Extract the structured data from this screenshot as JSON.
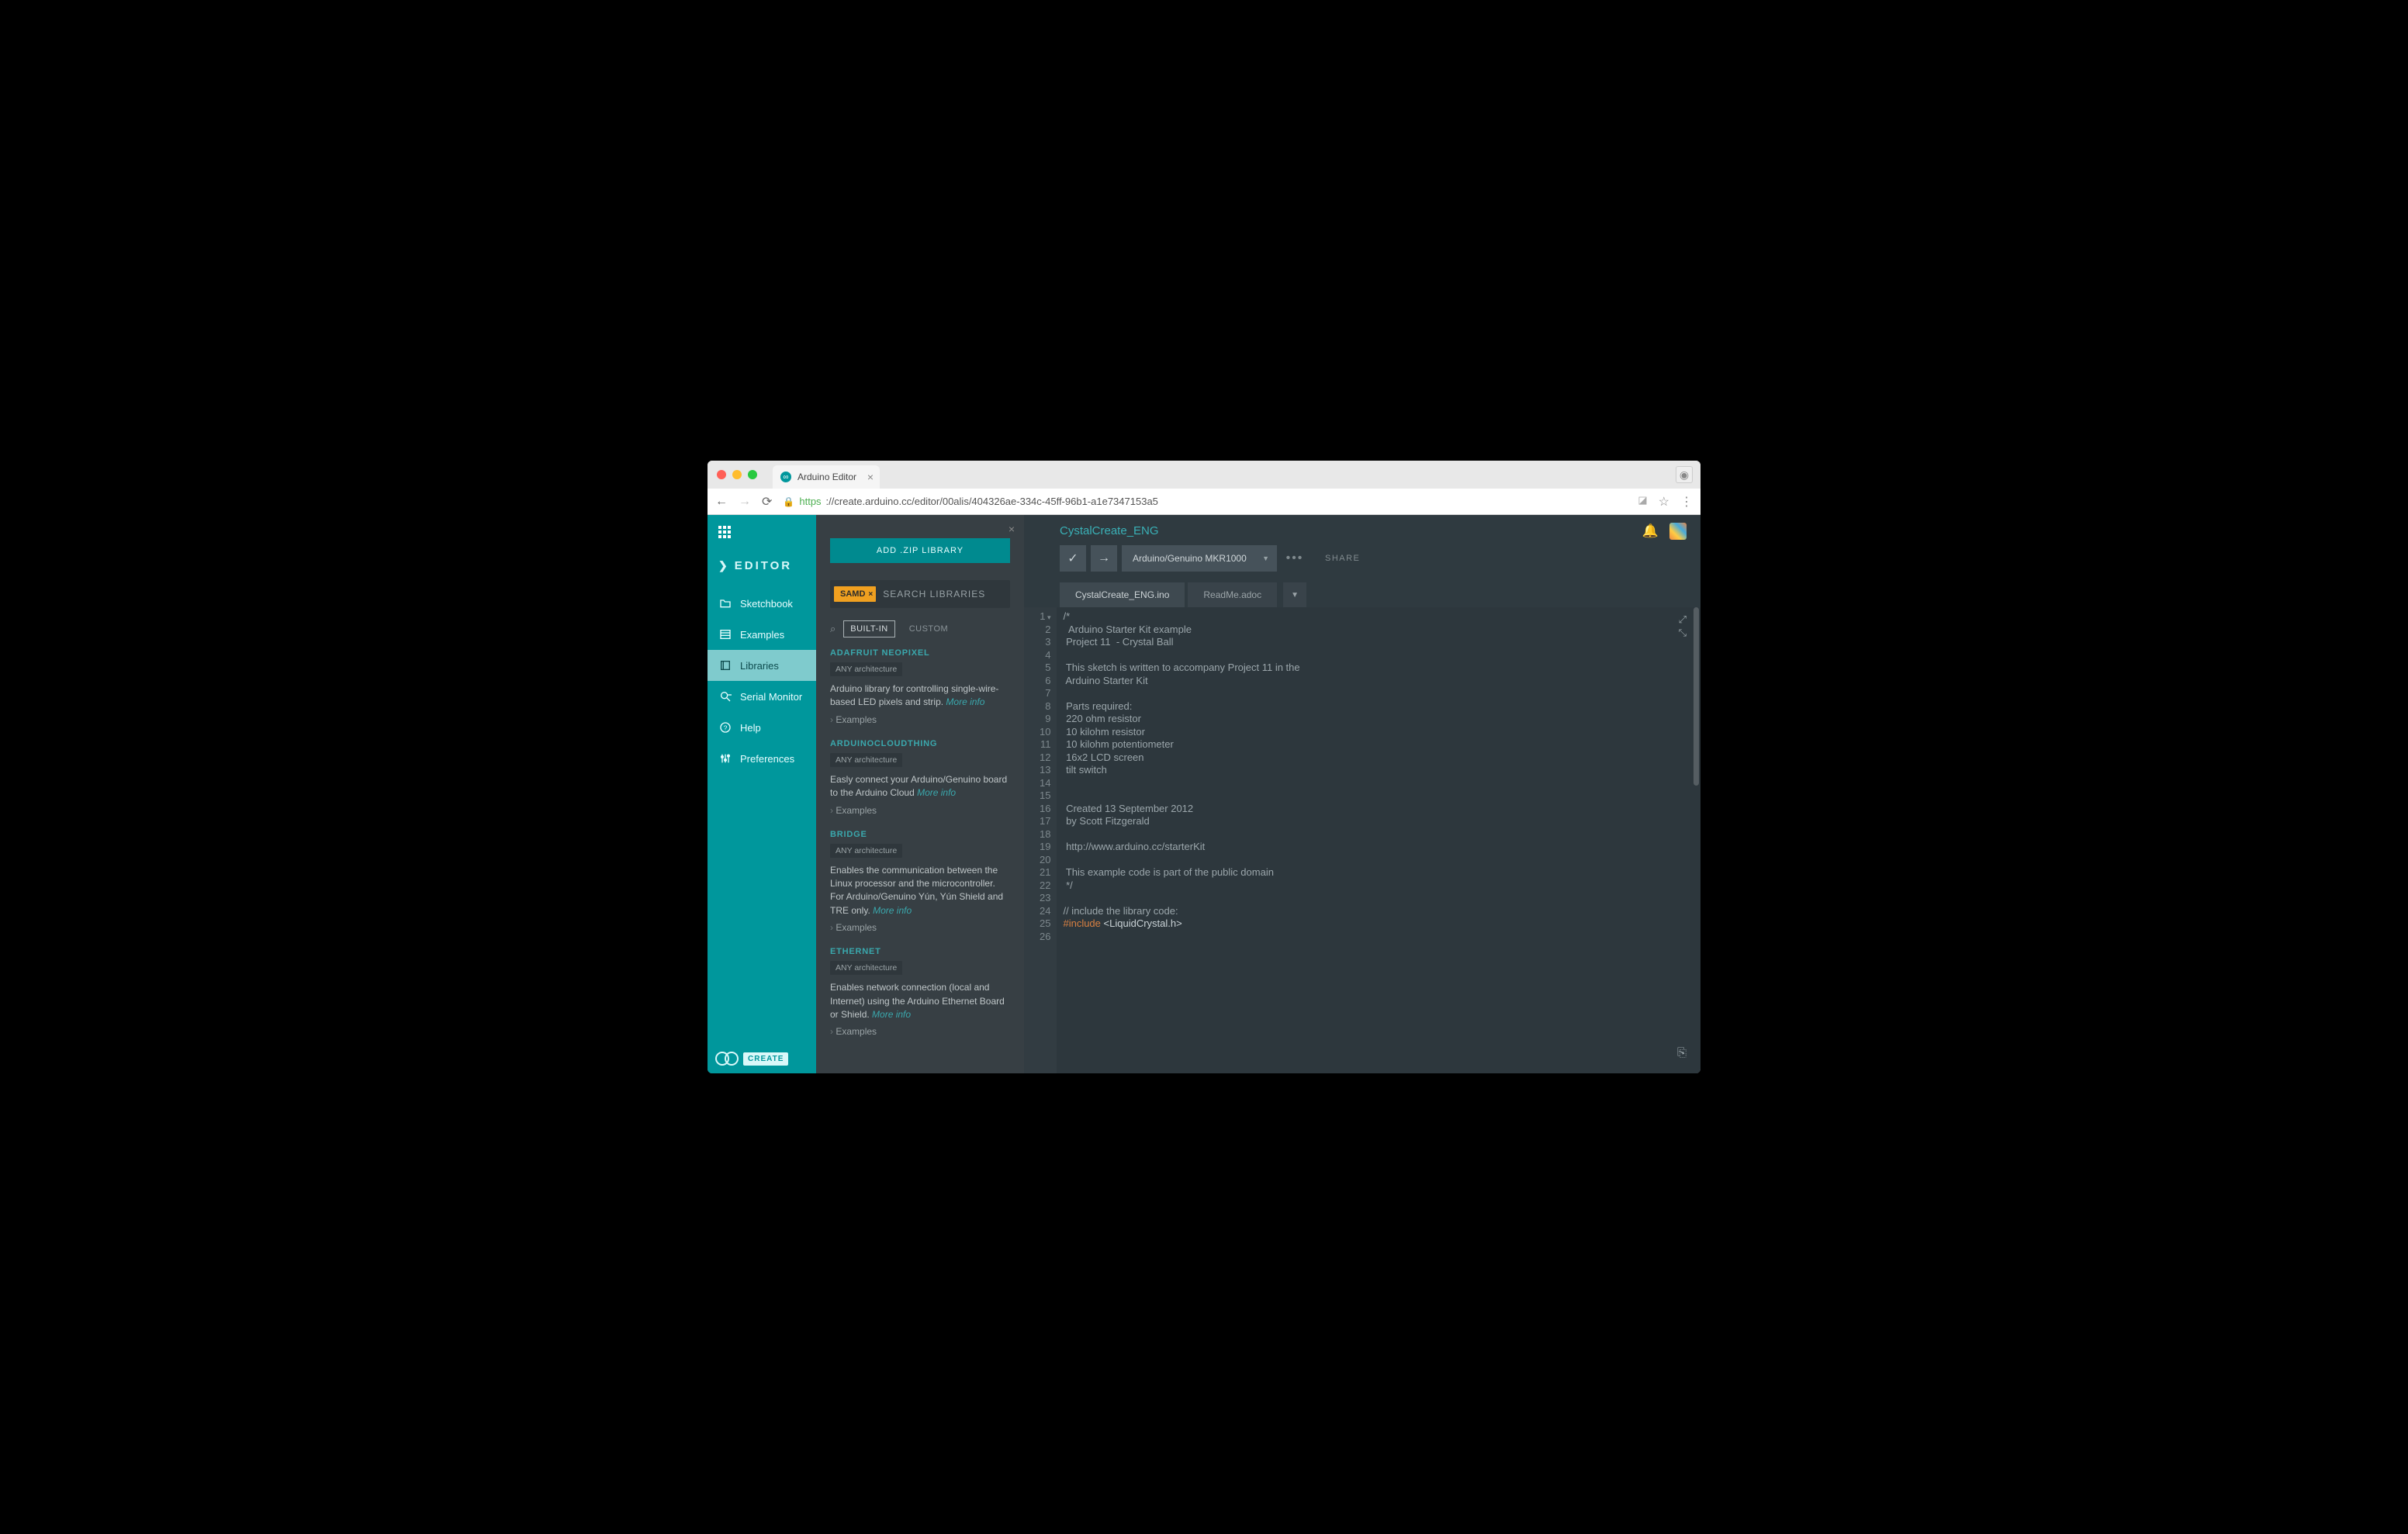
{
  "browser": {
    "tab_title": "Arduino Editor",
    "url_proto": "https",
    "url_display": "://create.arduino.cc/editor/00alis/404326ae-334c-45ff-96b1-a1e7347153a5"
  },
  "sidebar": {
    "brand": "EDITOR",
    "items": [
      {
        "icon": "folder",
        "label": "Sketchbook"
      },
      {
        "icon": "list",
        "label": "Examples"
      },
      {
        "icon": "book",
        "label": "Libraries"
      },
      {
        "icon": "serial",
        "label": "Serial Monitor"
      },
      {
        "icon": "help",
        "label": "Help"
      },
      {
        "icon": "sliders",
        "label": "Preferences"
      }
    ],
    "active_index": 2,
    "footer_brand": "CREATE"
  },
  "libraries_panel": {
    "add_button": "ADD .ZIP LIBRARY",
    "filter_chip": "SAMD",
    "search_placeholder": "SEARCH LIBRARIES",
    "filters": {
      "builtin": "BUILT-IN",
      "custom": "CUSTOM"
    },
    "active_filter": "builtin",
    "more_info": "More info",
    "examples_label": "Examples",
    "arch_label": "ANY architecture",
    "items": [
      {
        "name": "ADAFRUIT NEOPIXEL",
        "desc": "Arduino library for controlling single-wire-based LED pixels and strip."
      },
      {
        "name": "ARDUINOCLOUDTHING",
        "desc": "Easly connect your Arduino/Genuino board to the Arduino Cloud"
      },
      {
        "name": "BRIDGE",
        "desc": "Enables the communication between the Linux processor and the microcontroller. For Arduino/Genuino Yún, Yún Shield and TRE only."
      },
      {
        "name": "ETHERNET",
        "desc": "Enables network connection (local and Internet) using the Arduino Ethernet Board or Shield."
      }
    ]
  },
  "editor": {
    "sketch_name": "CystalCreate_ENG",
    "board": "Arduino/Genuino MKR1000",
    "share_label": "SHARE",
    "tabs": [
      {
        "label": "CystalCreate_ENG.ino",
        "active": true
      },
      {
        "label": "ReadMe.adoc",
        "active": false
      }
    ],
    "code_lines": [
      "/*",
      "  Arduino Starter Kit example",
      " Project 11  - Crystal Ball",
      "",
      " This sketch is written to accompany Project 11 in the",
      " Arduino Starter Kit",
      "",
      " Parts required:",
      " 220 ohm resistor",
      " 10 kilohm resistor",
      " 10 kilohm potentiometer",
      " 16x2 LCD screen",
      " tilt switch",
      "",
      "",
      " Created 13 September 2012",
      " by Scott Fitzgerald",
      "",
      " http://www.arduino.cc/starterKit",
      "",
      " This example code is part of the public domain",
      " */",
      "",
      "// include the library code:",
      "#include <LiquidCrystal.h>",
      ""
    ]
  }
}
